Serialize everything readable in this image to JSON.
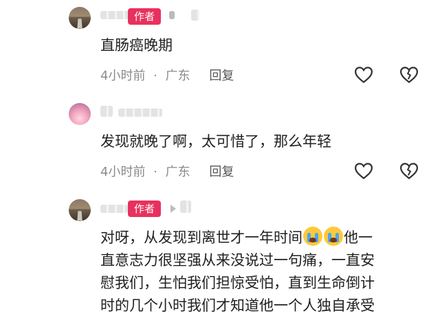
{
  "comments": [
    {
      "author_badge": "作者",
      "text": "直肠癌晚期",
      "time": "4小时前",
      "separator": "·",
      "location": "广东",
      "reply_label": "回复",
      "like_icon": "heart-outline-icon",
      "dislike_icon": "broken-heart-icon"
    },
    {
      "text": "发现就晚了啊，太可惜了，那么年轻",
      "time": "4小时前",
      "separator": "·",
      "location": "广东",
      "reply_label": "回复",
      "like_icon": "heart-outline-icon",
      "dislike_icon": "broken-heart-icon"
    },
    {
      "author_badge": "作者",
      "text_lines": [
        "对呀，从发现到离世才一年时间",
        "他一",
        "直意志力很坚强从来没说过一句痛，一直安",
        "慰我们，生怕我们担惊受怕，直到生命倒计",
        "时的几个小时我们才知道他一个人独自承受"
      ],
      "emoji_icon": "loudly-crying-face-emoji"
    }
  ],
  "colors": {
    "badge": "#e8315c",
    "meta": "#8a8a8a",
    "text": "#202020"
  }
}
